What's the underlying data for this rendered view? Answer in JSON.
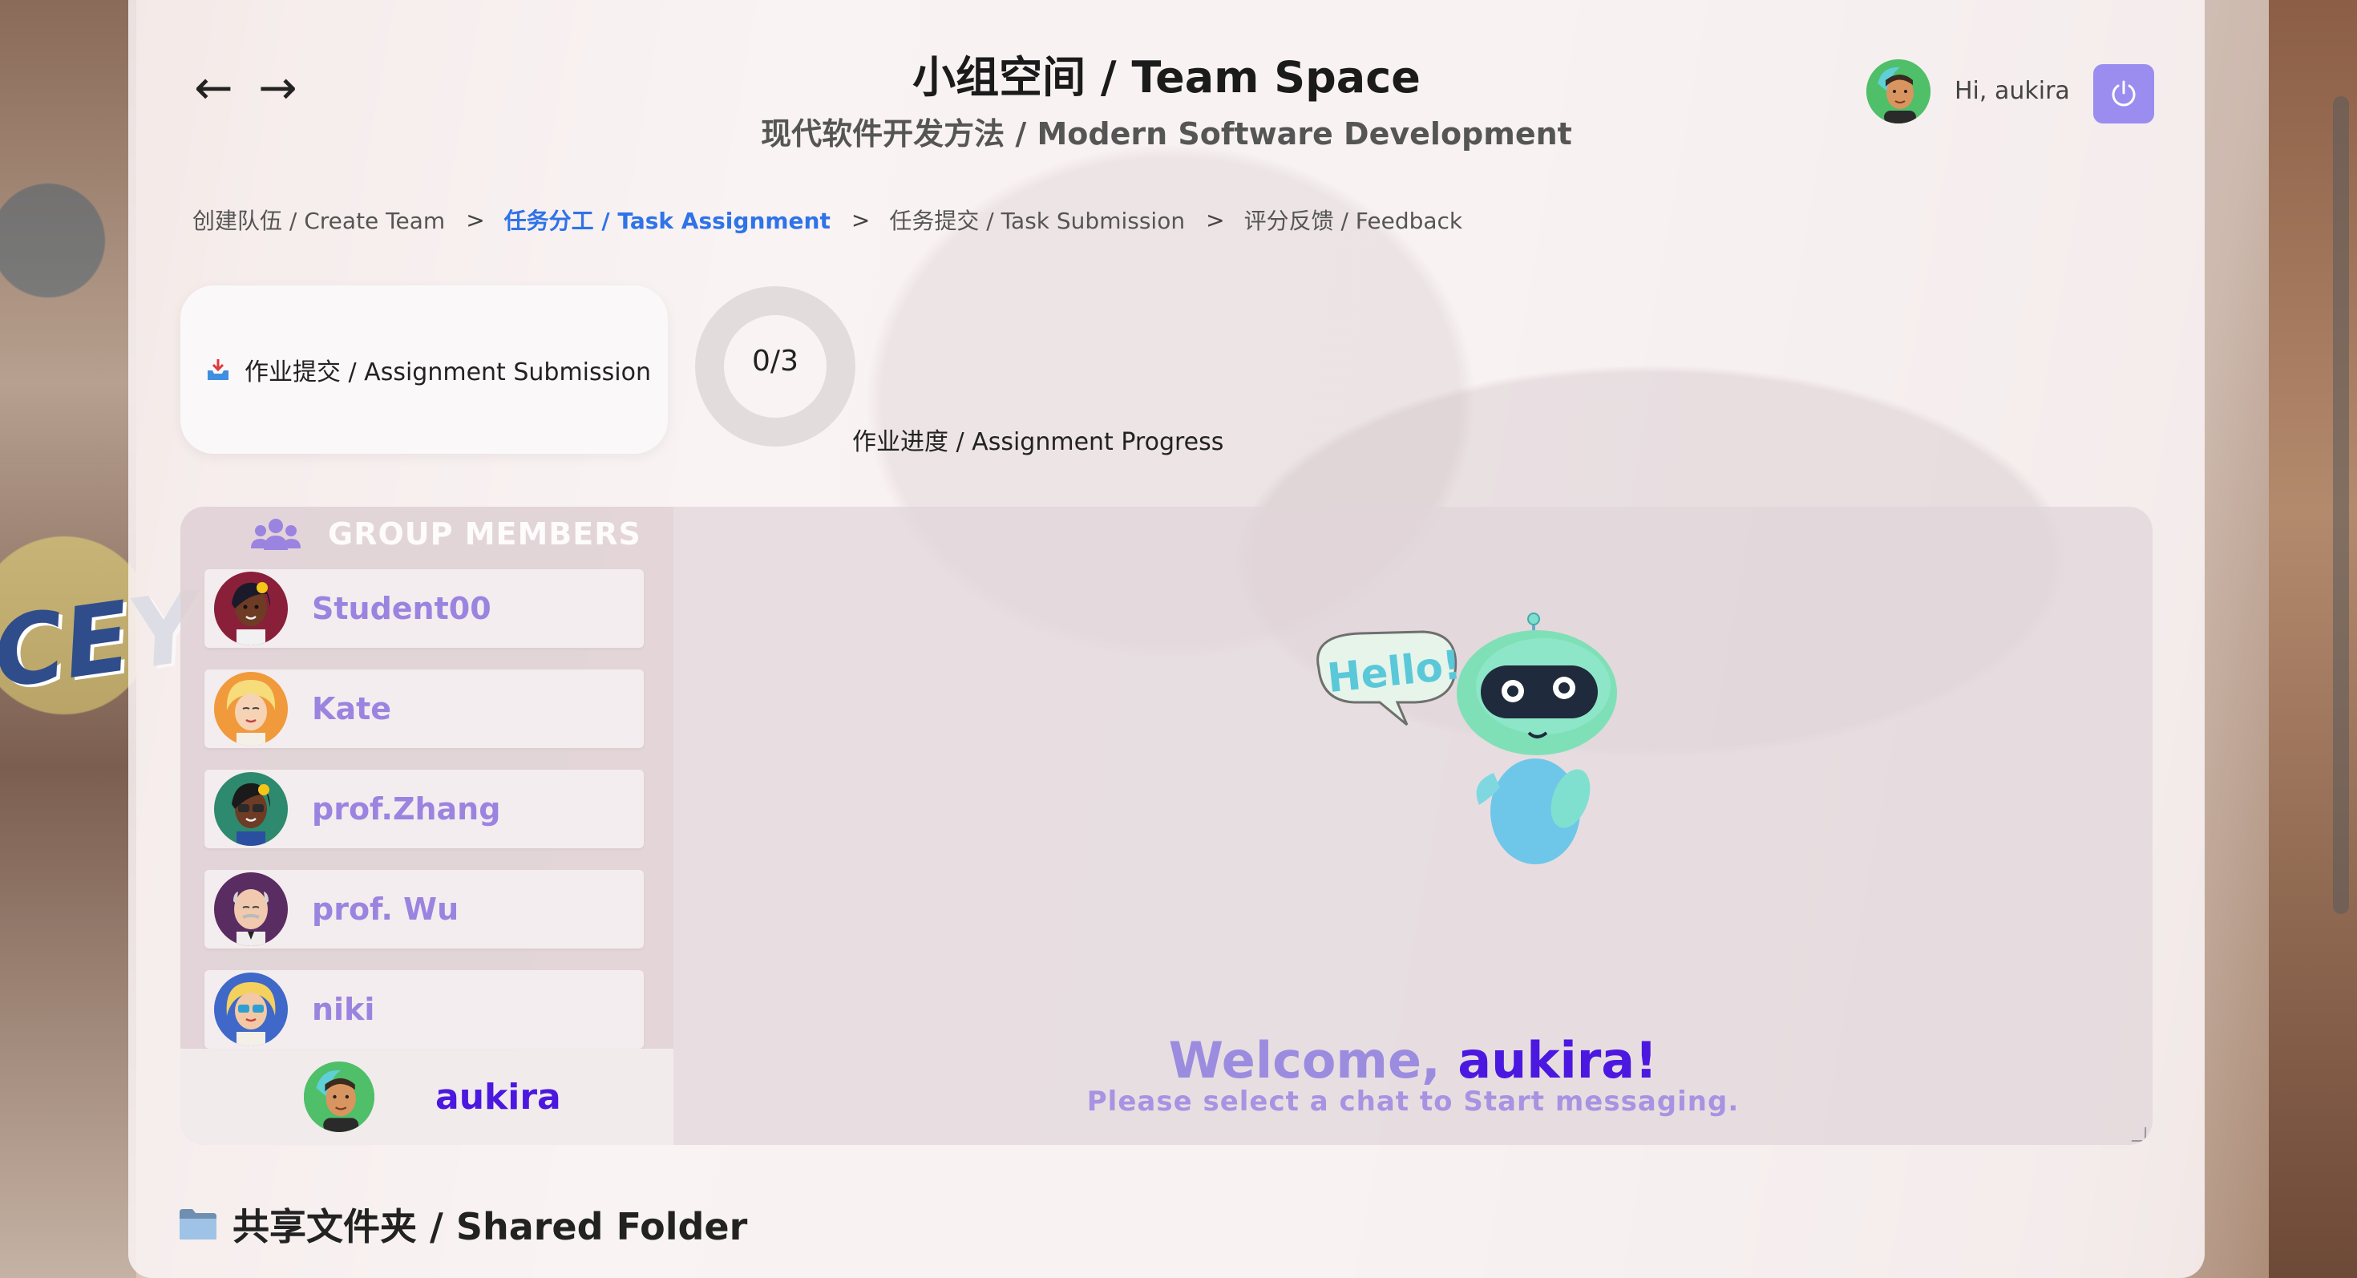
{
  "header": {
    "title": "小组空间 / Team Space",
    "subtitle": "现代软件开发方法 / Modern Software Development",
    "greeting": "Hi, aukira"
  },
  "nav": {
    "back_icon": "arrow-left-icon",
    "forward_icon": "arrow-right-icon"
  },
  "breadcrumb": {
    "items": [
      {
        "label": "创建队伍 / Create Team",
        "active": false
      },
      {
        "label": "任务分工 / Task Assignment",
        "active": true
      },
      {
        "label": "任务提交 / Task Submission",
        "active": false
      },
      {
        "label": "评分反馈 / Feedback",
        "active": false
      }
    ],
    "separator": ">"
  },
  "assignment": {
    "submit_label": "作业提交 / Assignment Submission",
    "progress_text": "0/3",
    "progress_done": 0,
    "progress_total": 3,
    "progress_label": "作业进度 / Assignment Progress"
  },
  "members": {
    "header": "GROUP MEMBERS",
    "list": [
      {
        "name": "Student00"
      },
      {
        "name": "Kate"
      },
      {
        "name": "prof.Zhang"
      },
      {
        "name": "prof. Wu"
      },
      {
        "name": "niki"
      }
    ],
    "current_user": "aukira"
  },
  "chat": {
    "robot_bubble": "Hello!",
    "welcome_prefix": "Welcome, ",
    "welcome_name": "aukira!",
    "welcome_sub": "Please select a chat to Start messaging."
  },
  "shared_folder": {
    "title": "共享文件夹 / Shared Folder"
  },
  "colors": {
    "accent": "#2f73e8",
    "purple": "#9b8cf0",
    "member_name": "#9b84e0",
    "current_user": "#4b18e0"
  }
}
